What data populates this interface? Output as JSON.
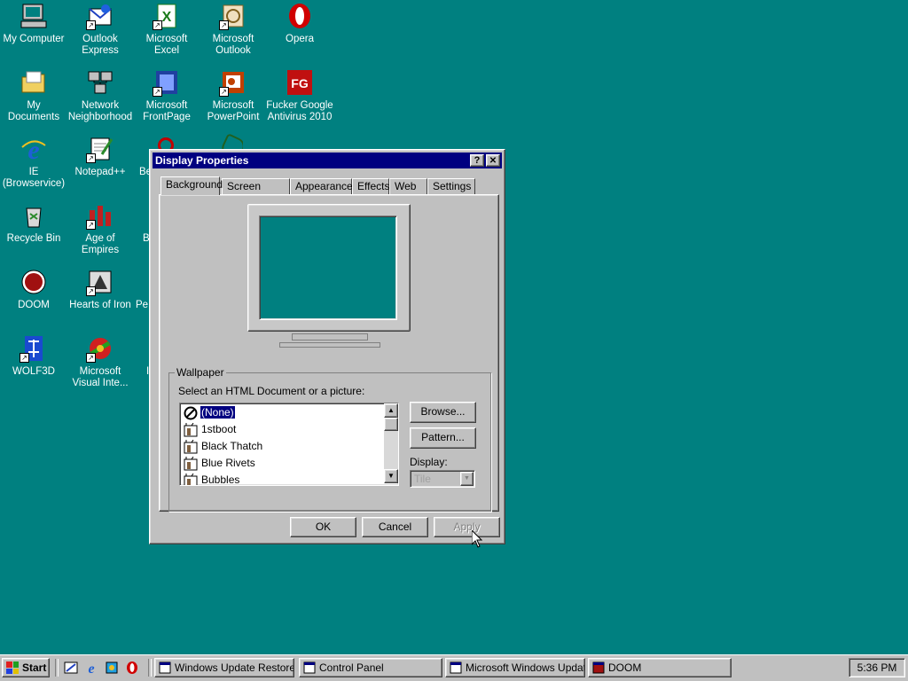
{
  "desktop": {
    "background": "#008080",
    "icons": [
      {
        "label": "My Computer",
        "icon": "computer-icon",
        "shortcut": false
      },
      {
        "label": "Outlook Express",
        "icon": "outlook-express-icon",
        "shortcut": true
      },
      {
        "label": "Microsoft Excel",
        "icon": "excel-icon",
        "shortcut": true
      },
      {
        "label": "Microsoft Outlook",
        "icon": "outlook-icon",
        "shortcut": true
      },
      {
        "label": "Opera",
        "icon": "opera-icon",
        "shortcut": false
      },
      {
        "label": "My Documents",
        "icon": "folder-icon",
        "shortcut": false
      },
      {
        "label": "Network Neighborhood",
        "icon": "network-icon",
        "shortcut": false
      },
      {
        "label": "Microsoft FrontPage",
        "icon": "frontpage-icon",
        "shortcut": true
      },
      {
        "label": "Microsoft PowerPoint",
        "icon": "powerpoint-icon",
        "shortcut": true
      },
      {
        "label": "Fucker Google Antivirus 2010",
        "icon": "antivirus-icon",
        "shortcut": false
      },
      {
        "label": "IE (Browservice)",
        "icon": "ie-icon",
        "shortcut": false
      },
      {
        "label": "Notepad++",
        "icon": "notepad-icon",
        "shortcut": true
      },
      {
        "label": "Recycle Bin",
        "icon": "recycle-bin-icon",
        "shortcut": false
      },
      {
        "label": "Age of Empires",
        "icon": "age-of-empires-icon",
        "shortcut": true
      },
      {
        "label": "DOOM",
        "icon": "doom-icon",
        "shortcut": false
      },
      {
        "label": "Hearts of Iron",
        "icon": "hearts-of-iron-icon",
        "shortcut": true
      },
      {
        "label": "WOLF3D",
        "icon": "wolf3d-icon",
        "shortcut": true
      },
      {
        "label": "Microsoft Visual Inte...",
        "icon": "visual-interdev-icon",
        "shortcut": true
      }
    ],
    "clipped_labels": [
      "Be",
      "B",
      "Pe",
      "I"
    ]
  },
  "dialog": {
    "title": "Display Properties",
    "help_button": "?",
    "close_button": "✕",
    "tabs": [
      "Background",
      "Screen Saver",
      "Appearance",
      "Effects",
      "Web",
      "Settings"
    ],
    "active_tab": "Background",
    "wallpaper_group": "Wallpaper",
    "select_label": "Select an HTML Document or a picture:",
    "wallpapers": [
      {
        "name": "(None)",
        "selected": true,
        "icon": "none-icon"
      },
      {
        "name": "1stboot",
        "selected": false,
        "icon": "paint-icon"
      },
      {
        "name": "Black Thatch",
        "selected": false,
        "icon": "paint-icon"
      },
      {
        "name": "Blue Rivets",
        "selected": false,
        "icon": "paint-icon"
      },
      {
        "name": "Bubbles",
        "selected": false,
        "icon": "paint-icon"
      }
    ],
    "browse_label": "Browse...",
    "pattern_label": "Pattern...",
    "display_label": "Display:",
    "display_value": "Tile",
    "ok_label": "OK",
    "cancel_label": "Cancel",
    "apply_label": "Apply",
    "monitor_color": "#008080"
  },
  "taskbar": {
    "start_label": "Start",
    "quick_launch": [
      "show-desktop-icon",
      "ie-icon",
      "channels-icon",
      "opera-icon"
    ],
    "items": [
      {
        "label": "Windows Update Restore...",
        "icon": "window-icon"
      },
      {
        "label": "Control Panel",
        "icon": "control-panel-icon"
      },
      {
        "label": "Microsoft Windows Updat...",
        "icon": "ie-icon"
      },
      {
        "label": "DOOM",
        "icon": "doom-icon"
      }
    ],
    "clock": "5:36 PM"
  }
}
